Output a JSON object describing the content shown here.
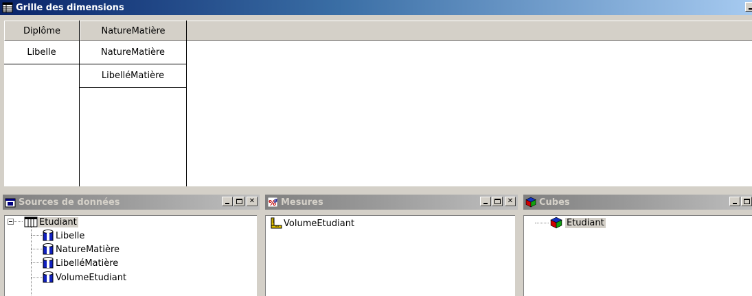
{
  "grid_window": {
    "title": "Grille des dimensions",
    "icon": "grid-icon",
    "columns": [
      {
        "header": "Diplôme",
        "cells": [
          "Libelle"
        ]
      },
      {
        "header": "NatureMatière",
        "cells": [
          "NatureMatière",
          "LibelléMatière"
        ]
      }
    ]
  },
  "data_sources": {
    "title": "Sources de données",
    "icon": "datasource-window-icon",
    "root": {
      "label": "Etudiant",
      "icon": "table-icon"
    },
    "fields": [
      {
        "label": "Libelle",
        "icon": "cylinder-field-icon"
      },
      {
        "label": "NatureMatière",
        "icon": "cylinder-field-icon"
      },
      {
        "label": "LibelléMatière",
        "icon": "cylinder-field-icon"
      },
      {
        "label": "VolumeEtudiant",
        "icon": "cylinder-field-icon"
      }
    ]
  },
  "measures": {
    "title": "Mesures",
    "icon": "measures-icon",
    "items": [
      {
        "label": "VolumeEtudiant",
        "icon": "measure-ruler-icon"
      }
    ]
  },
  "cubes": {
    "title": "Cubes",
    "icon": "cube-icon",
    "items": [
      {
        "label": "Etudiant",
        "icon": "cube-icon"
      }
    ]
  },
  "colors": {
    "active_title_start": "#0a246a",
    "active_title_end": "#a6caf0",
    "inactive_title_start": "#808080",
    "inactive_title_end": "#c0c0c0",
    "face": "#d4d0c8"
  }
}
